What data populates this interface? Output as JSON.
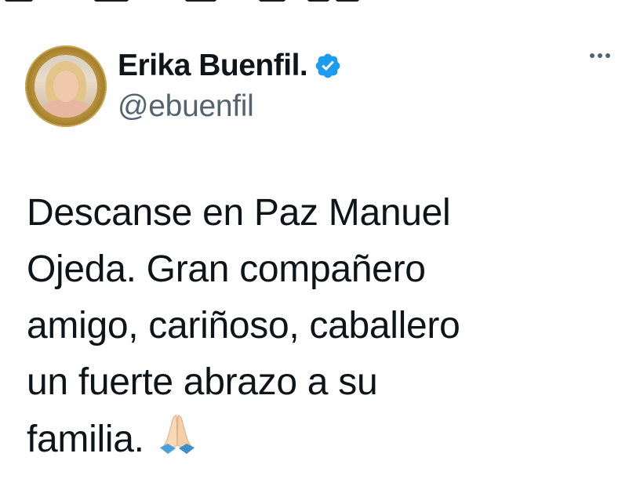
{
  "author": {
    "display_name": "Erika Buenfil.",
    "handle": "@ebuenfil",
    "verified": true,
    "verified_badge_color": "#1d9bf0"
  },
  "tweet": {
    "lines": [
      "Descanse en Paz Manuel",
      "Ojeda. Gran compañero",
      "amigo, cariñoso, caballero",
      "un fuerte abrazo a su",
      "familia."
    ],
    "emoji": "folded-hands-emoji"
  },
  "icons": {
    "more": "more-options-icon",
    "verified": "verified-badge-icon"
  },
  "colors": {
    "text": "#0f1419",
    "secondary": "#536471"
  }
}
